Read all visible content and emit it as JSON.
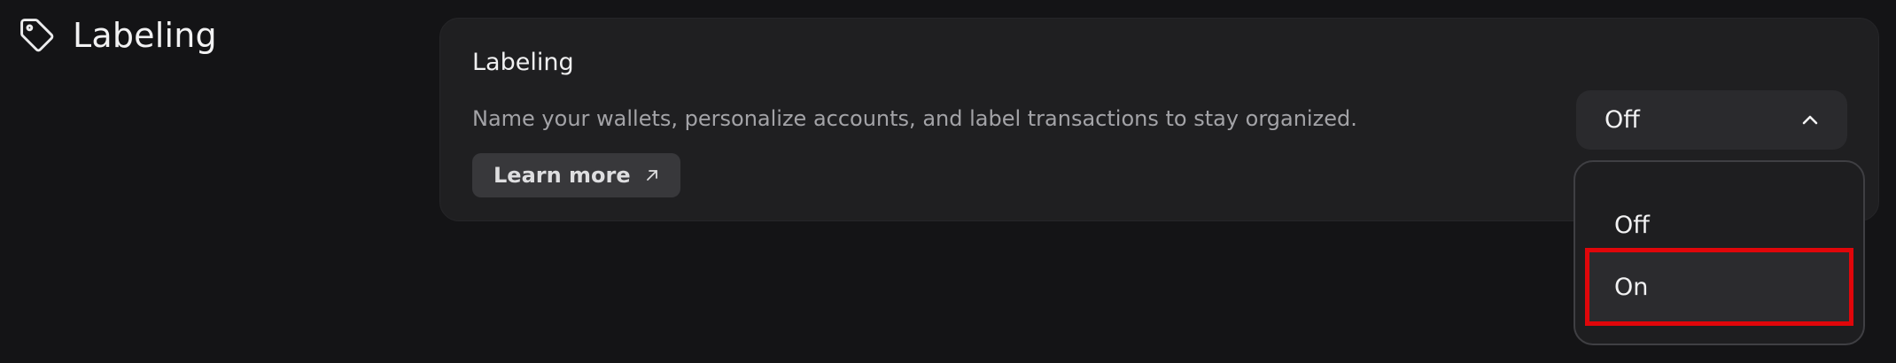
{
  "section": {
    "title": "Labeling",
    "icon": "tag-icon"
  },
  "card": {
    "title": "Labeling",
    "description": "Name your wallets, personalize accounts, and label transactions to stay organized.",
    "learn_more_label": "Learn more",
    "learn_more_icon": "arrow-up-right-icon"
  },
  "select": {
    "current_value": "Off",
    "chevron_icon": "chevron-up-icon",
    "options": [
      {
        "label": "Off"
      },
      {
        "label": "On"
      }
    ],
    "highlighted_option": "On",
    "highlight_color": "#e0060a"
  },
  "colors": {
    "background": "#141416",
    "card": "#1f1f21",
    "button": "#38383b",
    "text_primary": "#f2f2f3",
    "text_secondary": "#a3a3a7"
  }
}
